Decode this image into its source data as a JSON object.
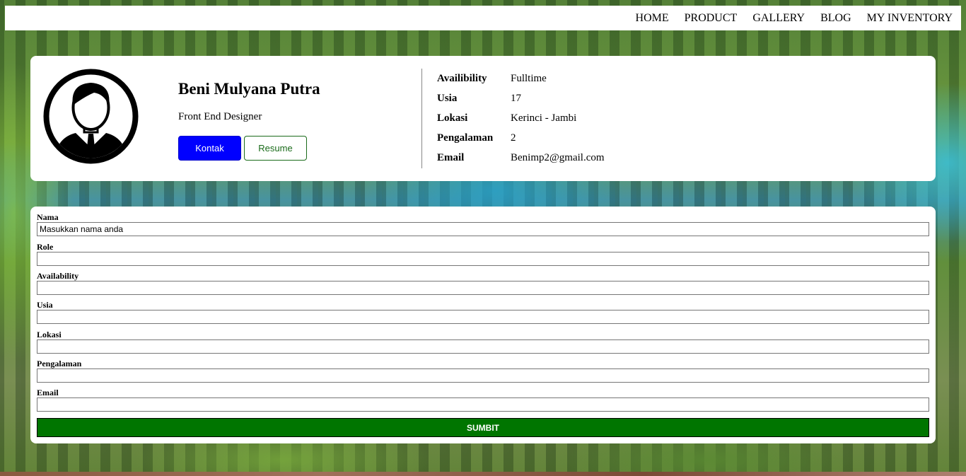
{
  "nav": {
    "items": [
      "HOME",
      "PRODUCT",
      "GALLERY",
      "BLOG",
      "MY INVENTORY"
    ]
  },
  "profile": {
    "avatar_icon": "user-avatar-icon",
    "name": "Beni Mulyana Putra",
    "role": "Front End Designer",
    "buttons": {
      "kontak": "Kontak",
      "resume": "Resume"
    },
    "info": [
      {
        "label": "Availibility",
        "value": "Fulltime"
      },
      {
        "label": "Usia",
        "value": "17"
      },
      {
        "label": "Lokasi",
        "value": "Kerinci - Jambi"
      },
      {
        "label": "Pengalaman",
        "value": "2"
      },
      {
        "label": "Email",
        "value": "Benimp2@gmail.com"
      }
    ]
  },
  "form": {
    "fields": [
      {
        "label": "Nama",
        "value": "Masukkan nama anda"
      },
      {
        "label": "Role",
        "value": ""
      },
      {
        "label": "Availability",
        "value": ""
      },
      {
        "label": "Usia",
        "value": ""
      },
      {
        "label": "Lokasi",
        "value": ""
      },
      {
        "label": "Pengalaman",
        "value": ""
      },
      {
        "label": "Email",
        "value": ""
      }
    ],
    "submit_label": "SUMBIT"
  },
  "colors": {
    "primary_button": "#0000ff",
    "secondary_button_border": "#1a6b1a",
    "submit_button": "#007500"
  }
}
